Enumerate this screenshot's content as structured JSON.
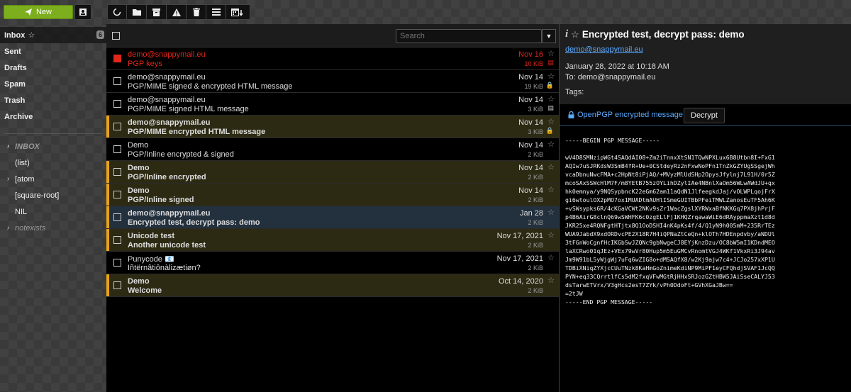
{
  "toolbar": {
    "new_label": "New"
  },
  "sidebar": {
    "folders": [
      {
        "label": "Inbox",
        "star": "☆",
        "count": "6"
      },
      {
        "label": "Sent"
      },
      {
        "label": "Drafts"
      },
      {
        "label": "Spam"
      },
      {
        "label": "Trash"
      },
      {
        "label": "Archive"
      }
    ],
    "subfolders": [
      {
        "label": "INBOX",
        "chevron": "›"
      },
      {
        "label": "(list)",
        "chevron": ""
      },
      {
        "label": "[atom",
        "chevron": "›"
      },
      {
        "label": "[square-root]",
        "chevron": ""
      },
      {
        "label": "NIL",
        "chevron": ""
      },
      {
        "label": "notexists",
        "chevron": "›"
      }
    ]
  },
  "list": {
    "search_placeholder": "Search",
    "messages": [
      {
        "from": "demo@snappymail.eu",
        "subject": "PGP keys",
        "date": "Nov 16",
        "size": "10 KiB",
        "star": "☆",
        "icon": "▤"
      },
      {
        "from": "demo@snappymail.eu",
        "subject": "PGP/MIME signed & encrypted HTML message",
        "date": "Nov 14",
        "size": "19 KiB",
        "star": "☆",
        "icon": "🔒"
      },
      {
        "from": "demo@snappymail.eu",
        "subject": "PGP/MIME signed HTML message",
        "date": "Nov 14",
        "size": "3 KiB",
        "star": "☆",
        "icon": "▤"
      },
      {
        "from": "demo@snappymail.eu",
        "subject": "PGP/MIME encrypted HTML message",
        "date": "Nov 14",
        "size": "3 KiB",
        "star": "☆",
        "icon": "🔒"
      },
      {
        "from": "Demo",
        "subject": "PGP/Inline encrypted & signed",
        "date": "Nov 14",
        "size": "2 KiB",
        "star": "☆",
        "icon": ""
      },
      {
        "from": "Demo",
        "subject": "PGP/Inline encrypted",
        "date": "Nov 14",
        "size": "2 KiB",
        "star": "☆",
        "icon": ""
      },
      {
        "from": "Demo",
        "subject": "PGP/Inline signed",
        "date": "Nov 14",
        "size": "2 KiB",
        "star": "☆",
        "icon": ""
      },
      {
        "from": "demo@snappymail.eu",
        "subject": "Encrypted test, decrypt pass: demo",
        "date": "Jan 28",
        "size": "2 KiB",
        "star": "☆",
        "icon": ""
      },
      {
        "from": "Unicode test",
        "subject": "Another unicode test",
        "date": "Nov 17, 2021",
        "size": "2 KiB",
        "star": "☆",
        "icon": ""
      },
      {
        "from": "Punycode 📧",
        "subject": "Iñtërnâtiônàlizætiøn?",
        "date": "Nov 17, 2021",
        "size": "2 KiB",
        "star": "☆",
        "icon": ""
      },
      {
        "from": "Demo",
        "subject": "Welcome",
        "date": "Oct 14, 2020",
        "size": "2 KiB",
        "star": "☆",
        "icon": ""
      }
    ]
  },
  "preview": {
    "info_glyph": "i",
    "star": "☆",
    "title": "Encrypted test, decrypt pass: demo",
    "from": "demo@snappymail.eu",
    "date": "January 28, 2022 at 10:18 AM",
    "to": "To: demo@snappymail.eu",
    "tags": "Tags:",
    "pgp_label": "OpenPGP encrypted message",
    "decrypt_label": "Decrypt",
    "pgp_text": "-----BEGIN PGP MESSAGE-----\n\nwV4D8SMNzipWGt4SAQdAI08+Zm2iTnnxXtSN1TQwNPXLux6B8Utbn8I+FxG1\nAQIw7uSJRKdsW3SmB4fR+Ue+0CStdeyRz2nFxwNoPFn1TnZkGZYUgSSgejWh\nvcaDbnuNwcFMA+c2HpNt8iPjAQ/+MVyzMlUdSHp2OpysJfylnj7L91H/0r5Z\nmcoSAxSSWcHlM7F/m8YEtB755zOYLihDZylIAe4NBnlXaOm56WLwAWdJU+qx\nhk0emnya/y9NQSypbncK22eGm62am11aQdN1JlfeegkdJaj/vOLWPLqojFrX\ngi6wtoulOX2pMO7ox1MUADtmAUHlISmeGUITBbPFeiTMWLZanosEuTF5Ah6K\n+vSWsypks6R/4cKGaVCWt2NKv9sZr1WacZgslXYRWxaBfNKKGq7PX8jhPrjF\np4B6AirG8clnQ69wSWHFK6c0zgELlFj1KHQZrqawaWiE6dRAyppmaXzt1d8d\nJKR25xe4RQNFgtHTjtx8Q1OoDSHI4nK4pKs4f/4/Q1yN9h005mM+235RrTEz\nWUA9JabdX9xdORDvcPE2X18R7H4iQPNaZtCeQn+klOTh7HDEnpdvby/aNDUl\n3tFGnWoCgnfHcIKGbSwJZQNc9gbNwgeCJ8EYjKnzDzu/OC8bW5mI1KDndMEO\nlaXCRwo01qJEz+VEx79wVr80Hup5m5EuGMCvRnomtVGJ4WKf1VkxRi3J94av\nJm9W91bL5yWjgWj7uFq6wZIG8o+dMSAQfX8/w2Kj9ajw7c4+JCJo257xXP1U\nTDBiXNiqZYXjcCUuTNzk8KaHmGoZnimeKdiNP9MiPF1eyCFQhdjSVAF1JcQQ\nPYN+eq33CQrrtlfCs5dM2fxqVFwMGtRjHHxSRJozGZtHBW5JAiSseCALYJ53\ndsTarwETVrx/V3gHcs2esT7ZYk/vPh0DdoFt+GVhXGaJBw==\n=2tJW\n-----END PGP MESSAGE-----"
  },
  "colors": {
    "accent_green": "#7cae1e",
    "unread_bar": "#e8a317",
    "flag_red": "#e0261a",
    "link_blue": "#5aa9ff"
  }
}
